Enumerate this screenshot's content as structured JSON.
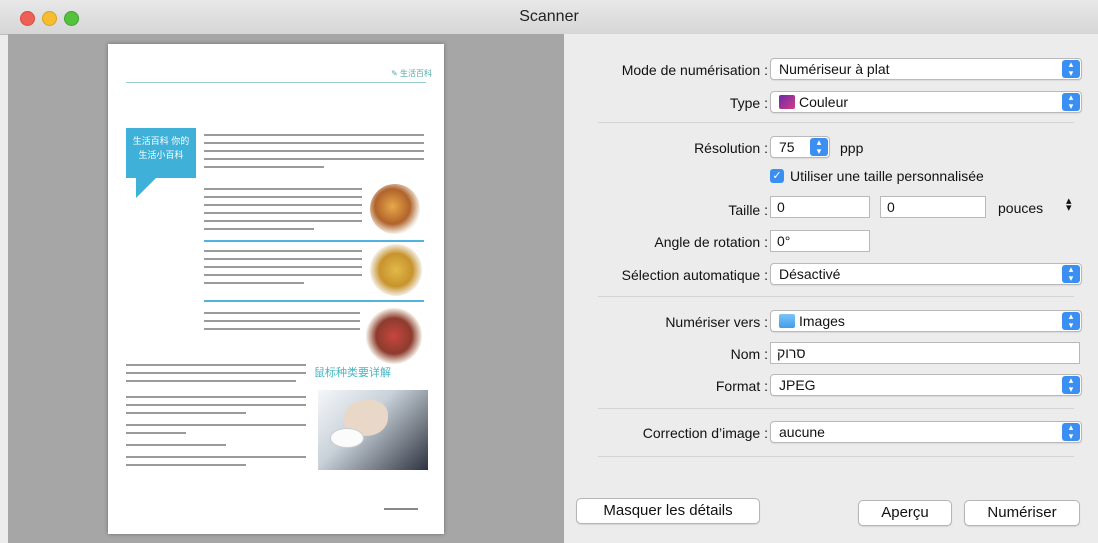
{
  "window": {
    "title": "Scanner"
  },
  "preview": {
    "page_header": "✎ 生活百科",
    "box_title": "生活百科 你的生活小百科",
    "photo_heading": "鼠标种类要详解",
    "footer": ""
  },
  "settings": {
    "scan_mode": {
      "label": "Mode de numérisation :",
      "value": "Numériseur à plat"
    },
    "type": {
      "label": "Type :",
      "value": "Couleur",
      "icon": "color-swatch-icon"
    },
    "resolution": {
      "label": "Résolution :",
      "value": "75",
      "unit": "ppp"
    },
    "custom_size": {
      "label": "Utiliser une taille personnalisée",
      "checked": true
    },
    "size": {
      "label": "Taille :",
      "width": "0",
      "height": "0",
      "unit": "pouces"
    },
    "rotation": {
      "label": "Angle de rotation :",
      "value": "0°"
    },
    "auto_selection": {
      "label": "Sélection automatique :",
      "value": "Désactivé"
    },
    "scan_to": {
      "label": "Numériser vers :",
      "value": "Images",
      "icon": "folder-icon"
    },
    "name": {
      "label": "Nom :",
      "value": "סרוק"
    },
    "format": {
      "label": "Format :",
      "value": "JPEG"
    },
    "image_correction": {
      "label": "Correction d’image :",
      "value": "aucune"
    }
  },
  "buttons": {
    "hide_details": "Masquer les détails",
    "preview": "Aperçu",
    "scan": "Numériser"
  },
  "colors": {
    "accent": "#3b8ff3",
    "preview_background": "#a6a6a6",
    "panel_background": "#ececec"
  }
}
